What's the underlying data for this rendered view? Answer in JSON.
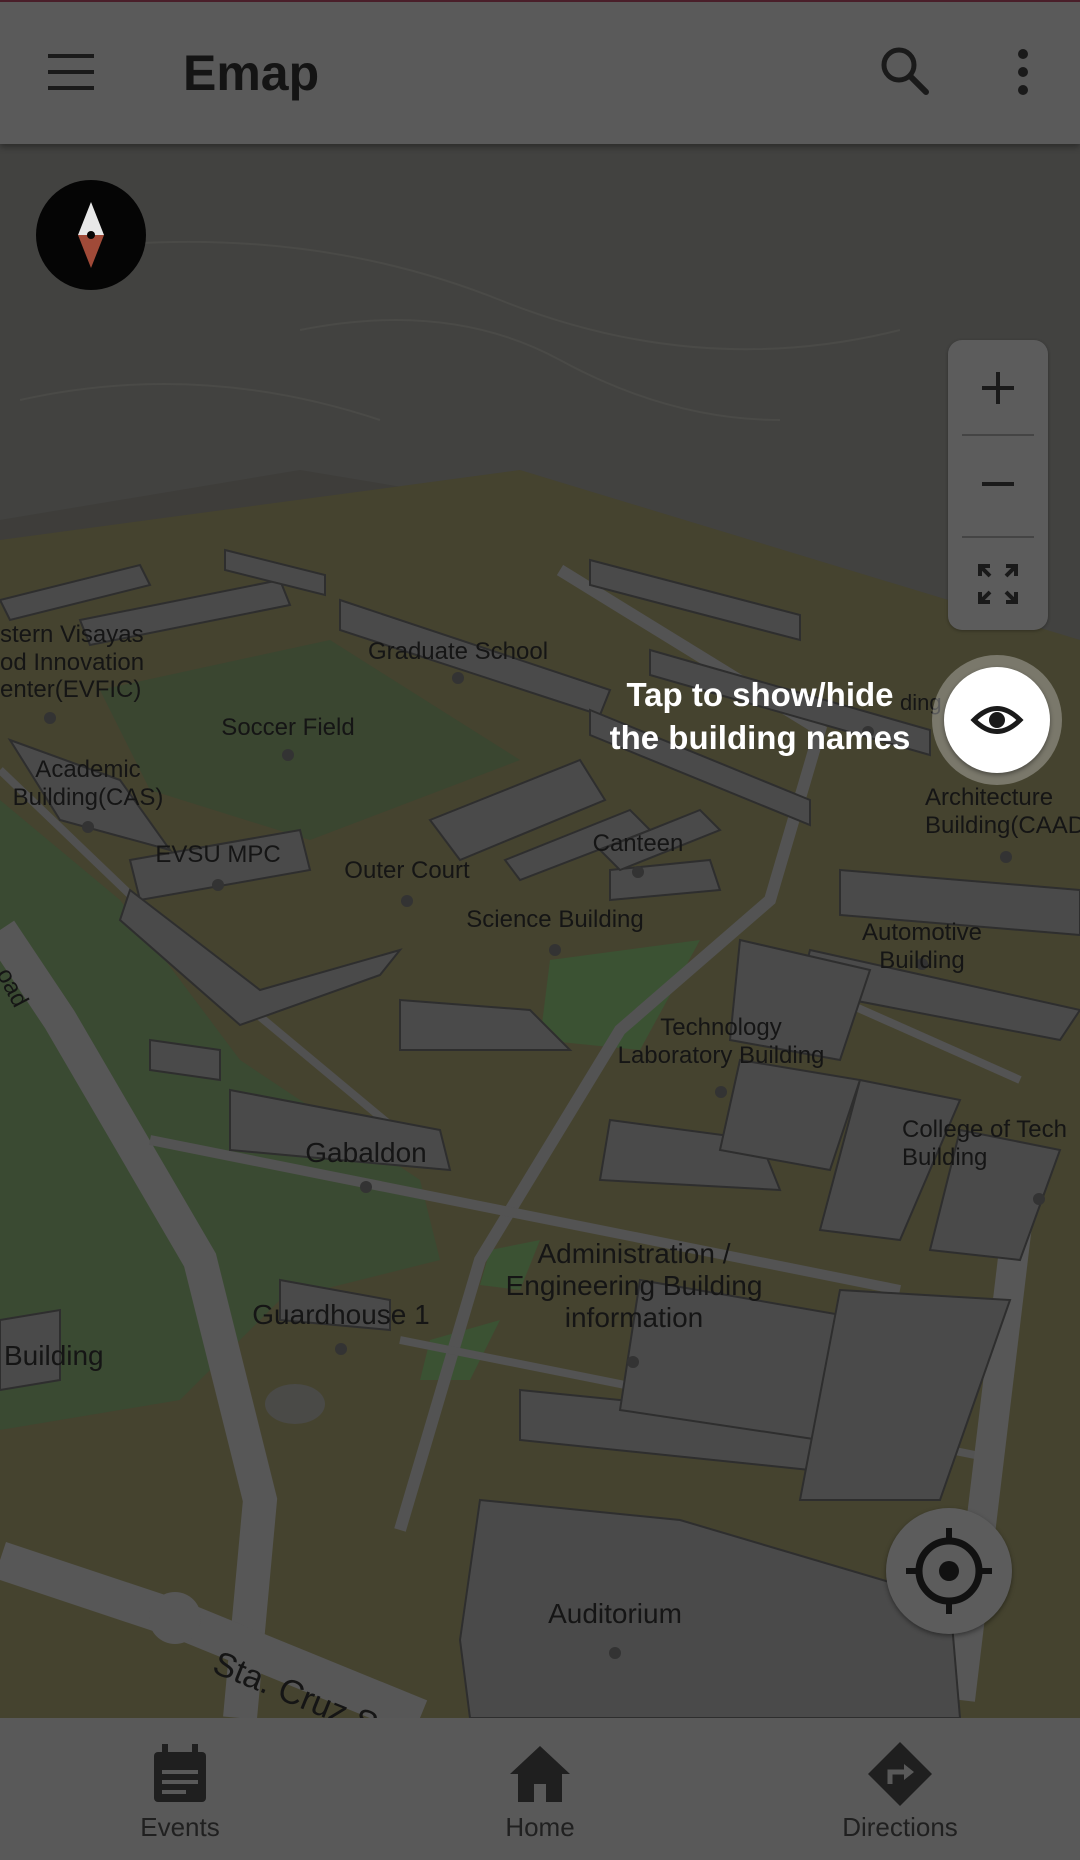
{
  "app": {
    "title": "Emap",
    "menu_icon": "menu-icon",
    "search_icon": "search-icon",
    "more_icon": "more-vert-icon"
  },
  "map": {
    "labels": {
      "eastern_visayas": "stern Visayas\nod Innovation\nenter(EVFIC)",
      "graduate_school": "Graduate School",
      "soccer_field": "Soccer Field",
      "academic_building": "Academic\nBuilding(CAS)",
      "evsu_mpc": "EVSU MPC",
      "outer_court": "Outer Court",
      "canteen": "Canteen",
      "science_building": "Science Building",
      "architecture_building": "Architecture\nBuilding(CAAD",
      "automotive_building": "Automotive Building",
      "technology_lab": "Technology\nLaboratory Building",
      "college_of_tech": "College of Tech\nBuilding",
      "gabaldon": "Gabaldon",
      "administration": "Administration /\nEngineering Building\ninformation",
      "guardhouse": "Guardhouse 1",
      "building_left": "Building",
      "auditorium": "Auditorium",
      "road_partial": "oad",
      "sta_cruz": "Sta. Cruz S",
      "hidden_ding": "ding"
    },
    "compass_icon": "compass-icon",
    "zoom_in_icon": "plus-icon",
    "zoom_out_icon": "minus-icon",
    "fullscreen_icon": "fullscreen-icon",
    "locate_icon": "my-location-icon"
  },
  "onboarding": {
    "tooltip": "Tap to show/hide\nthe building names",
    "eye_icon": "eye-icon"
  },
  "bottom_nav": [
    {
      "label": "Events",
      "icon": "events-icon"
    },
    {
      "label": "Home",
      "icon": "home-icon"
    },
    {
      "label": "Directions",
      "icon": "directions-icon"
    }
  ]
}
